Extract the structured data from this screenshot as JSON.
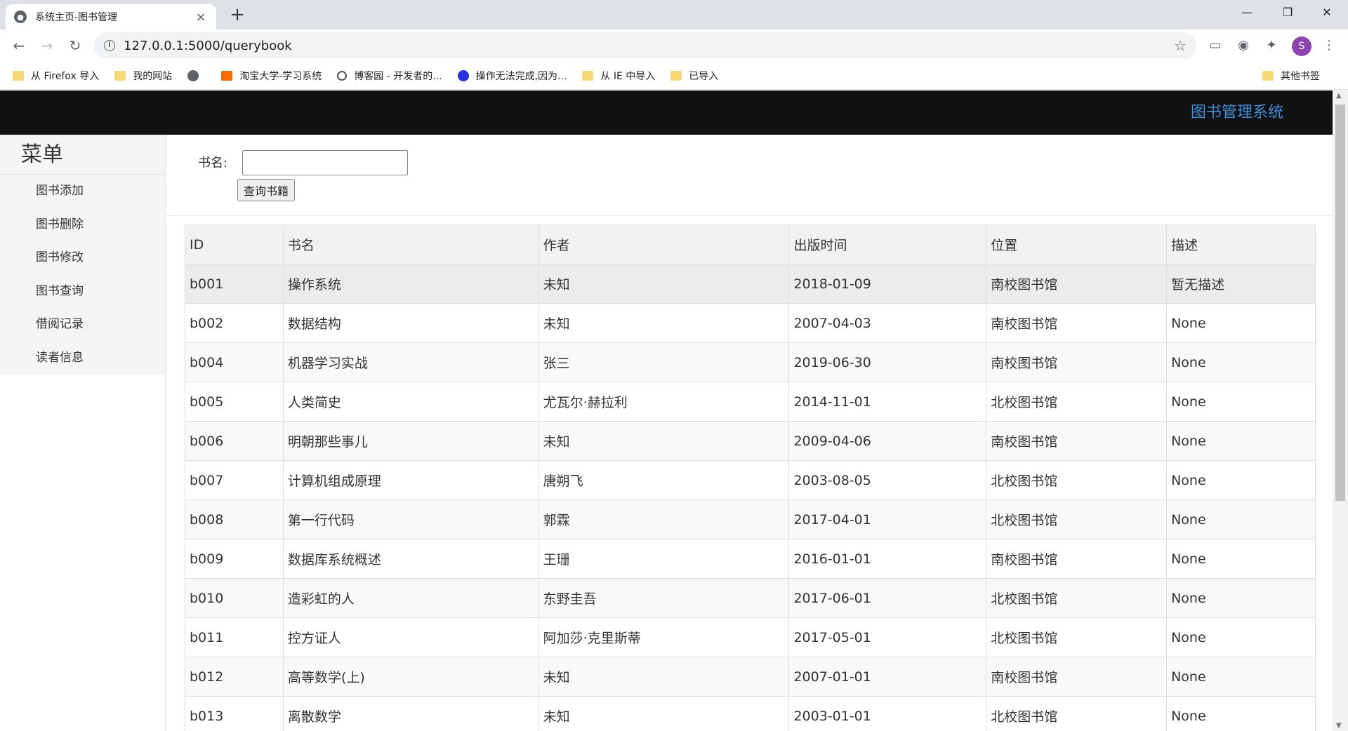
{
  "browser": {
    "tab_title": "系统主页-图书管理",
    "tab_close": "×",
    "new_tab": "+",
    "url": "127.0.0.1:5000/querybook",
    "avatar_letter": "S",
    "bookmarks": [
      {
        "label": "从 Firefox 导入",
        "icon": "folder"
      },
      {
        "label": "我的网站",
        "icon": "folder"
      },
      {
        "label": "",
        "icon": "globe"
      },
      {
        "label": "淘宝大学-学习系统",
        "icon": "taobao"
      },
      {
        "label": "博客园 - 开发者的...",
        "icon": "cnblogs"
      },
      {
        "label": "操作无法完成,因为...",
        "icon": "baidu"
      },
      {
        "label": "从 IE 中导入",
        "icon": "folder"
      },
      {
        "label": "已导入",
        "icon": "folder"
      }
    ],
    "other_bookmarks": "其他书签"
  },
  "navbar": {
    "brand": "图书管理系统"
  },
  "sidebar": {
    "title": "菜单",
    "items": [
      {
        "label": "图书添加"
      },
      {
        "label": "图书删除"
      },
      {
        "label": "图书修改"
      },
      {
        "label": "图书查询"
      },
      {
        "label": "借阅记录"
      },
      {
        "label": "读者信息"
      }
    ]
  },
  "search": {
    "label": "书名:",
    "value": "",
    "button_label": "查询书籍"
  },
  "table": {
    "headers": [
      "ID",
      "书名",
      "作者",
      "出版时间",
      "位置",
      "描述"
    ],
    "rows": [
      [
        "b001",
        "操作系统",
        "未知",
        "2018-01-09",
        "南校图书馆",
        "暂无描述"
      ],
      [
        "b002",
        "数据结构",
        "未知",
        "2007-04-03",
        "南校图书馆",
        "None"
      ],
      [
        "b004",
        "机器学习实战",
        "张三",
        "2019-06-30",
        "南校图书馆",
        "None"
      ],
      [
        "b005",
        "人类简史",
        "尤瓦尔·赫拉利",
        "2014-11-01",
        "北校图书馆",
        "None"
      ],
      [
        "b006",
        "明朝那些事儿",
        "未知",
        "2009-04-06",
        "南校图书馆",
        "None"
      ],
      [
        "b007",
        "计算机组成原理",
        "唐朔飞",
        "2003-08-05",
        "北校图书馆",
        "None"
      ],
      [
        "b008",
        "第一行代码",
        "郭霖",
        "2017-04-01",
        "北校图书馆",
        "None"
      ],
      [
        "b009",
        "数据库系统概述",
        "王珊",
        "2016-01-01",
        "南校图书馆",
        "None"
      ],
      [
        "b010",
        "造彩虹的人",
        "东野圭吾",
        "2017-06-01",
        "北校图书馆",
        "None"
      ],
      [
        "b011",
        "控方证人",
        "阿加莎·克里斯蒂",
        "2017-05-01",
        "北校图书馆",
        "None"
      ],
      [
        "b012",
        "高等数学(上)",
        "未知",
        "2007-01-01",
        "南校图书馆",
        "None"
      ],
      [
        "b013",
        "离散数学",
        "未知",
        "2003-01-01",
        "北校图书馆",
        "None"
      ]
    ]
  },
  "colors": {
    "navbar_bg": "#111111",
    "brand": "#3f8ddb"
  }
}
